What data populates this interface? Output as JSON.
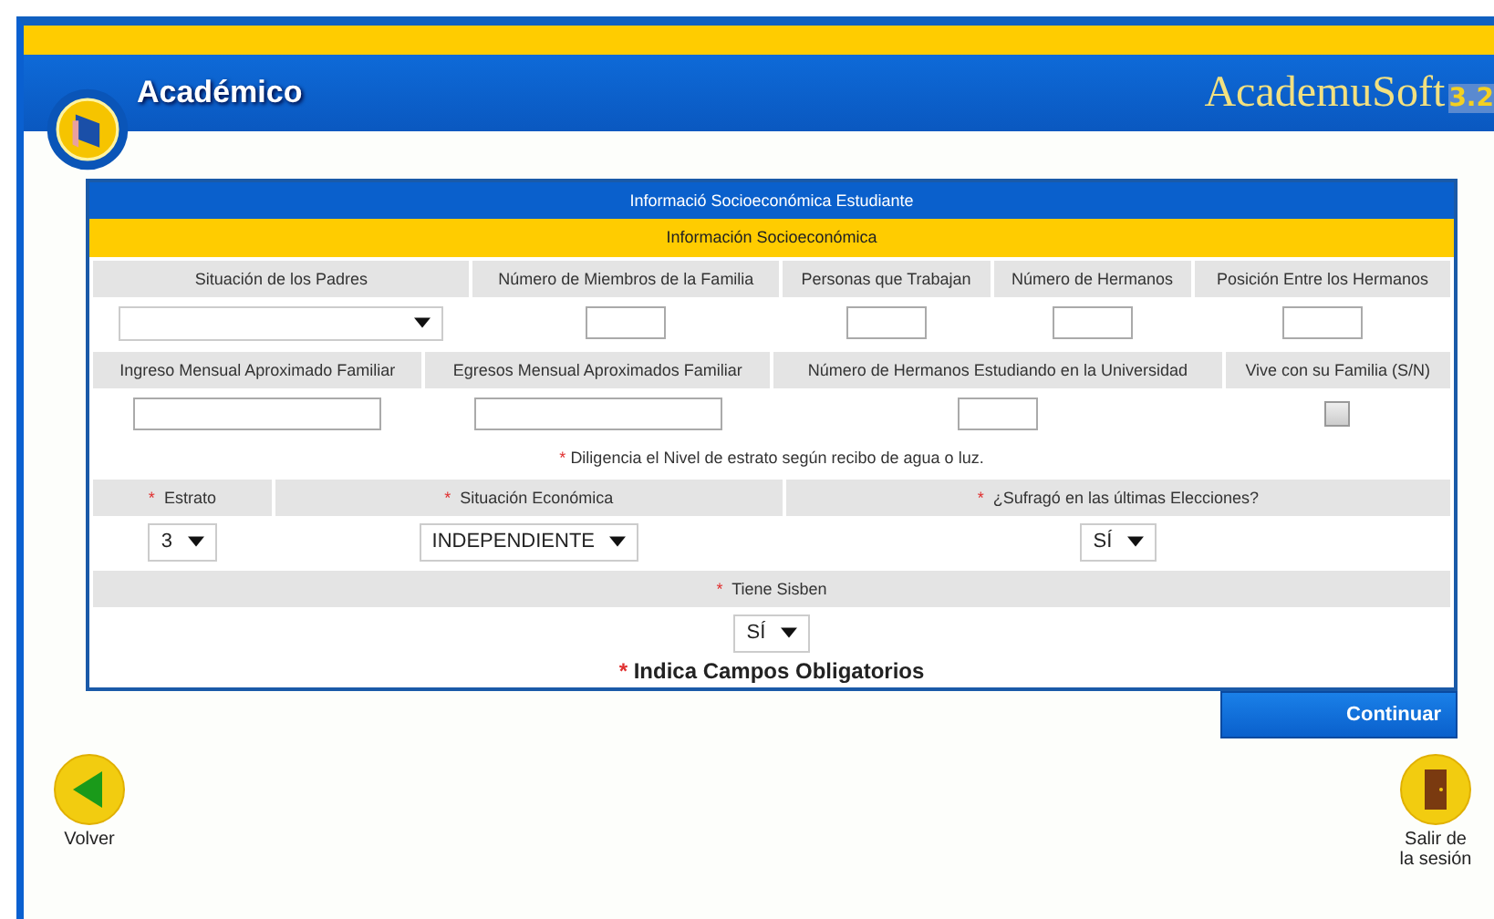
{
  "header": {
    "title": "Académico",
    "brand": "AcademuSoft",
    "version": "3.2"
  },
  "form": {
    "title": "Informació Socioeconómica Estudiante",
    "section": "Información Socioeconómica",
    "rows": [
      {
        "fields": [
          {
            "label": "Situación de los Padres",
            "kind": "select"
          },
          {
            "label": "Número de Miembros de la Familia",
            "kind": "input"
          },
          {
            "label": "Personas que Trabajan",
            "kind": "input"
          },
          {
            "label": "Número de Hermanos",
            "kind": "input"
          },
          {
            "label": "Posición Entre los Hermanos",
            "kind": "input"
          }
        ]
      },
      {
        "fields": [
          {
            "label": "Ingreso Mensual Aproximado Familiar",
            "kind": "wide-input"
          },
          {
            "label": "Egresos Mensual Aproximados Familiar",
            "kind": "wide-input"
          },
          {
            "label": "Número de Hermanos Estudiando en la Universidad",
            "kind": "input"
          },
          {
            "label": "Vive con su Familia (S/N)",
            "kind": "checkbox",
            "checked": false
          }
        ]
      },
      {
        "note_mark": "*",
        "note": "Diligencia el Nivel de estrato según recibo de agua o luz."
      },
      {
        "fields": [
          {
            "mark": "*",
            "label": "Estrato",
            "kind": "select",
            "value": "3"
          },
          {
            "mark": "*",
            "label": "Situación Económica",
            "kind": "select",
            "value": "INDEPENDIENTE"
          },
          {
            "mark": "*",
            "label": "¿Sufragó en las últimas Elecciones?",
            "kind": "select",
            "value": "SÍ"
          }
        ]
      },
      {
        "fields": [
          {
            "mark": "*",
            "label": "Tiene Sisben",
            "kind": "select",
            "value": "SÍ"
          }
        ]
      }
    ],
    "footnote_mark": "*",
    "footnote": "Indica Campos Obligatorios"
  },
  "continue_button": "Continuar",
  "back_button": "Volver",
  "logout_button": "Salir de la sesión"
}
